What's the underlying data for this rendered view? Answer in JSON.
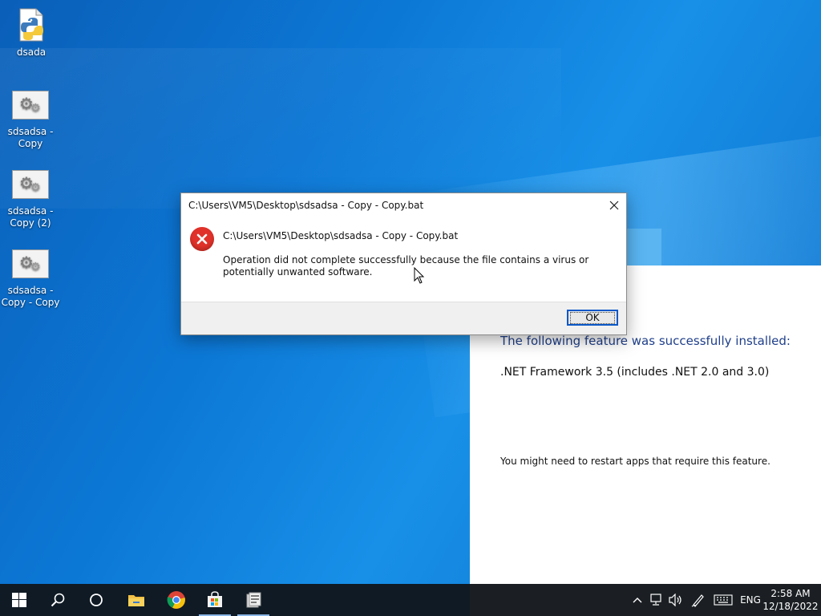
{
  "desktop": {
    "icons": [
      {
        "label": "dsada",
        "icon": "python-file-icon"
      },
      {
        "label": "sdsadsa - Copy",
        "icon": "batch-file-icon"
      },
      {
        "label": "sdsadsa - Copy (2)",
        "icon": "batch-file-icon"
      },
      {
        "label": "sdsadsa - Copy - Copy",
        "icon": "batch-file-icon"
      }
    ]
  },
  "dialog": {
    "title": "C:\\Users\\VM5\\Desktop\\sdsadsa - Copy - Copy.bat",
    "path": "C:\\Users\\VM5\\Desktop\\sdsadsa - Copy - Copy.bat",
    "message": "Operation did not complete successfully because the file contains a virus or potentially unwanted software.",
    "ok_label": "OK",
    "icon": "error-icon"
  },
  "feature_window": {
    "heading": "The following feature was successfully installed:",
    "feature": ".NET Framework 3.5 (includes .NET 2.0 and 3.0)",
    "note": "You might need to restart apps that require this feature."
  },
  "taskbar": {
    "buttons": [
      "start-icon",
      "search-icon",
      "task-view-icon",
      "file-explorer-icon",
      "chrome-icon",
      "store-icon",
      "windows-features-icon"
    ],
    "tray": {
      "language": "ENG",
      "time": "2:58 AM",
      "date": "12/18/2022"
    }
  },
  "colors": {
    "accent": "#0a58c8",
    "error": "#e0322a",
    "heading_blue": "#1f3f8a"
  }
}
